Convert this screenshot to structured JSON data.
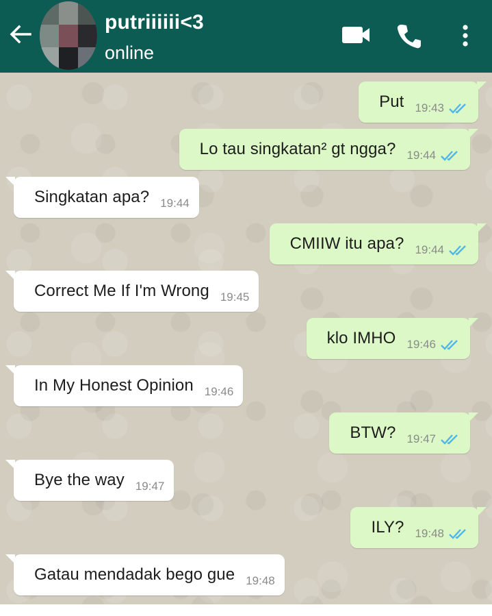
{
  "header": {
    "contact_name": "putriiiiii<3",
    "status": "online",
    "icons": [
      "back-arrow-icon",
      "avatar",
      "video-call-icon",
      "phone-call-icon",
      "more-menu-icon"
    ]
  },
  "colors": {
    "header": "#0d5c53",
    "outgoing_bubble": "#dcf8c6",
    "incoming_bubble": "#ffffff",
    "read_ticks": "#4fb6ec",
    "wallpaper": "#d3cdbf"
  },
  "messages": [
    {
      "direction": "out",
      "text": "Put",
      "time": "19:43",
      "read": true
    },
    {
      "direction": "out",
      "text": "Lo tau singkatan² gt ngga?",
      "time": "19:44",
      "read": true
    },
    {
      "direction": "in",
      "text": "Singkatan apa?",
      "time": "19:44"
    },
    {
      "direction": "out",
      "text": "CMIIW itu apa?",
      "time": "19:44",
      "read": true
    },
    {
      "direction": "in",
      "text": "Correct Me If I'm Wrong",
      "time": "19:45"
    },
    {
      "direction": "out",
      "text": "klo IMHO",
      "time": "19:46",
      "read": true
    },
    {
      "direction": "in",
      "text": "In My Honest Opinion",
      "time": "19:46"
    },
    {
      "direction": "out",
      "text": "BTW?",
      "time": "19:47",
      "read": true
    },
    {
      "direction": "in",
      "text": "Bye the way",
      "time": "19:47"
    },
    {
      "direction": "out",
      "text": "ILY?",
      "time": "19:48",
      "read": true
    },
    {
      "direction": "in",
      "text": "Gatau mendadak bego gue",
      "time": "19:48"
    }
  ]
}
